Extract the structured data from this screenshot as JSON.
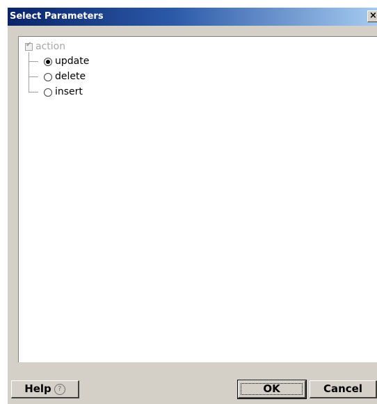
{
  "window": {
    "title": "Select Parameters",
    "close_label": "×"
  },
  "tree": {
    "root": {
      "label": "action",
      "checked": true,
      "disabled": true
    },
    "options": [
      {
        "label": "update",
        "selected": true
      },
      {
        "label": "delete",
        "selected": false
      },
      {
        "label": "insert",
        "selected": false
      }
    ]
  },
  "buttons": {
    "help_label": "Help",
    "help_icon": "?",
    "ok_label": "OK",
    "cancel_label": "Cancel"
  }
}
